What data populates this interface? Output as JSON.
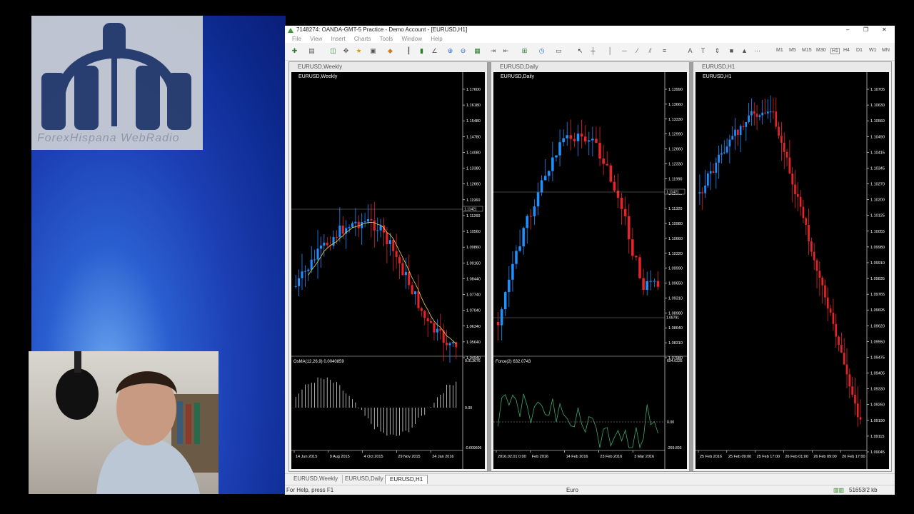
{
  "window": {
    "title": "7148274: OANDA-GMT-5 Practice - Demo Account - [EURUSD,H1]"
  },
  "overlay": {
    "logo_text": "ForexHispana WebRadio"
  },
  "menu": [
    "File",
    "View",
    "Insert",
    "Charts",
    "Tools",
    "Window",
    "Help"
  ],
  "timeframes": [
    "M1",
    "M5",
    "M15",
    "M30",
    "H1",
    "H4",
    "D1",
    "W1",
    "MN"
  ],
  "charts": [
    {
      "window_title": "EURUSD,Weekly",
      "label": "EURUSD,Weekly",
      "price_labels": [
        "1.17600",
        "1.16180",
        "1.15480",
        "1.14780",
        "1.14080",
        "1.13380",
        "1.12660",
        "1.11960",
        "1.11260",
        "1.10560",
        "1.09860",
        "1.09160",
        "1.08440",
        "1.07740",
        "1.07040",
        "1.06340",
        "1.05640",
        "1.04940"
      ],
      "current_price": "1.11421",
      "indicator_label": "OsMA(12,26,9) 0.0040859",
      "indicator_levels": [
        "0.013676",
        "0.00",
        "-0.009605"
      ],
      "time_labels": [
        "14 Jun 2015",
        "9 Aug 2015",
        "4 Oct 2015",
        "29 Nov 2015",
        "24 Jan 2016"
      ]
    },
    {
      "window_title": "EURUSD,Daily",
      "label": "EURUSD,Daily",
      "price_labels": [
        "1.13990",
        "1.13660",
        "1.13330",
        "1.12990",
        "1.12660",
        "1.12330",
        "1.11990",
        "1.11660",
        "1.11320",
        "1.10980",
        "1.10660",
        "1.10320",
        "1.09990",
        "1.09650",
        "1.09310",
        "1.08980",
        "1.08640",
        "1.08310",
        "1.07980"
      ],
      "current_price": "1.11421",
      "lower_price": "1.08791",
      "indicator_label": "Force(2) 632.0743",
      "indicator_levels": [
        "694.0335",
        "0.00",
        "-269.803"
      ],
      "time_labels": [
        "2016.02.01 0:00",
        "Feb 2016",
        "14 Feb 2016",
        "23 Feb 2016",
        "3 Mar 2016"
      ]
    },
    {
      "window_title": "EURUSD,H1",
      "label": "EURUSD,H1",
      "price_labels": [
        "1.10705",
        "1.10630",
        "1.10560",
        "1.10490",
        "1.10415",
        "1.10345",
        "1.10270",
        "1.10200",
        "1.10125",
        "1.10055",
        "1.09980",
        "1.09910",
        "1.09835",
        "1.09765",
        "1.09695",
        "1.09620",
        "1.09550",
        "1.09475",
        "1.09405",
        "1.09330",
        "1.09260",
        "1.09190",
        "1.09115",
        "1.09045"
      ],
      "time_labels": [
        "25 Feb 2016",
        "25 Feb 09:00",
        "25 Feb 17:00",
        "26 Feb 01:00",
        "26 Feb 09:00",
        "26 Feb 17:00"
      ]
    }
  ],
  "tabs": [
    {
      "label": "EURUSD,Weekly",
      "active": false
    },
    {
      "label": "EURUSD,Daily",
      "active": false
    },
    {
      "label": "EURUSD,H1",
      "active": true
    }
  ],
  "status": {
    "help": "For Help, press F1",
    "profile": "Euro",
    "traffic": "51653/2 kb"
  },
  "colors": {
    "bull": "#1e90ff",
    "bear": "#e8232a",
    "ma": "#e6d25a",
    "force": "#3fa66f"
  }
}
